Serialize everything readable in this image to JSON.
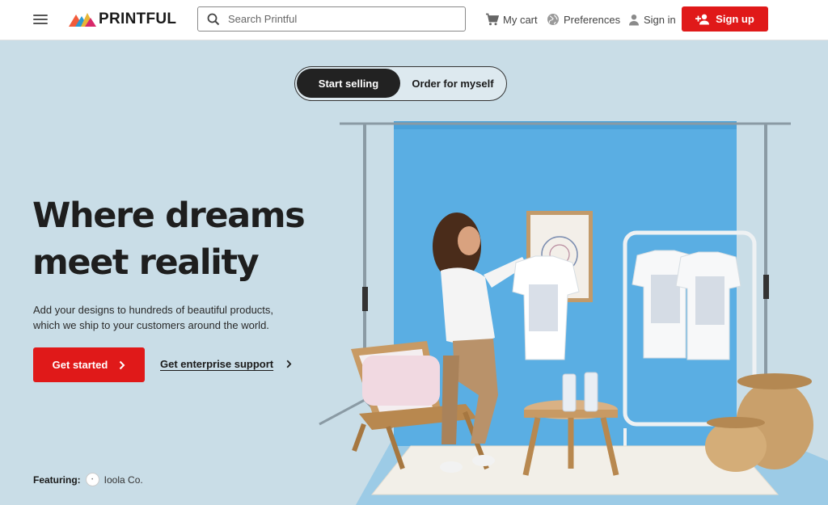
{
  "header": {
    "logo_text": "PRINTFUL",
    "search_placeholder": "Search Printful",
    "cart_label": "My cart",
    "preferences_label": "Preferences",
    "signin_label": "Sign in",
    "signup_label": "Sign up"
  },
  "toggle": {
    "active_label": "Start selling",
    "inactive_label": "Order for myself"
  },
  "hero": {
    "headline_line1": "Where dreams",
    "headline_line2": "meet reality",
    "subtext": "Add your designs to hundreds of beautiful products, which we ship to your customers around the world.",
    "cta_label": "Get started",
    "secondary_label": "Get enterprise support"
  },
  "featuring": {
    "label": "Featuring:",
    "name": "Ioola Co."
  },
  "colors": {
    "accent_red": "#e01919",
    "hero_background": "#c9dde7",
    "backdrop_blue": "#5aaee3"
  },
  "icons": [
    "menu-icon",
    "search-icon",
    "cart-icon",
    "globe-icon",
    "person-icon",
    "add-person-icon",
    "chevron-right-icon"
  ]
}
